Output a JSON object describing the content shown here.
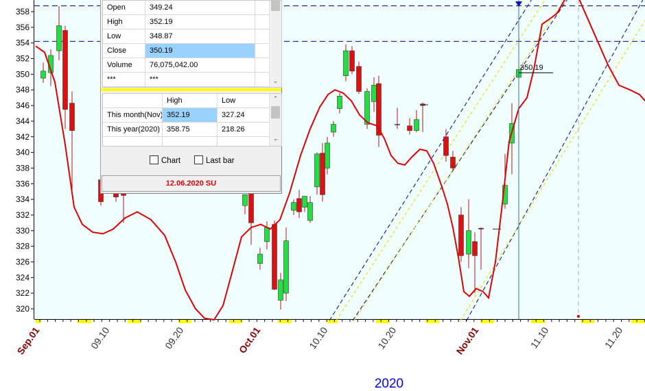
{
  "chart_data": {
    "type": "candlestick",
    "year_label": "2020",
    "y_ticks": [
      320,
      322,
      324,
      326,
      328,
      330,
      332,
      334,
      336,
      338,
      340,
      342,
      344,
      346,
      348,
      350,
      352,
      354,
      356,
      358
    ],
    "ylim": [
      318.5,
      359.8
    ],
    "x_ticks": [
      {
        "label": "Sep.01",
        "bold": true
      },
      {
        "label": "09.10",
        "bold": false
      },
      {
        "label": "09.20",
        "bold": false
      },
      {
        "label": "Oct.01",
        "bold": true
      },
      {
        "label": "10.10",
        "bold": false
      },
      {
        "label": "10.20",
        "bold": false
      },
      {
        "label": "Nov.01",
        "bold": true
      },
      {
        "label": "11.10",
        "bold": false
      },
      {
        "label": "11.20",
        "bold": false
      }
    ],
    "last_price_label": "350.19",
    "horizontal_lines": [
      358.75,
      354.2
    ],
    "candles": [
      {
        "o": 349.5,
        "h": 351.5,
        "l": 348.9,
        "c": 350.4
      },
      {
        "o": 350.2,
        "h": 353.2,
        "l": 348.5,
        "c": 352.4
      },
      {
        "o": 353.0,
        "h": 358.7,
        "l": 351.8,
        "c": 356.2
      },
      {
        "o": 355.6,
        "h": 356.2,
        "l": 343.0,
        "c": 345.5
      },
      {
        "o": 346.3,
        "h": 347.8,
        "l": 335.0,
        "c": 342.8
      },
      {
        "o": 336.5,
        "h": 337.5,
        "l": 333.2,
        "c": 333.7
      },
      {
        "o": 336.0,
        "h": 336.8,
        "l": 333.7,
        "c": 334.3
      },
      {
        "o": 336.4,
        "h": 337.2,
        "l": 331.0,
        "c": 334.5
      },
      {
        "o": 333.2,
        "h": 334.2,
        "l": 332.1,
        "c": 334.6
      },
      {
        "o": 335.0,
        "h": 336.0,
        "l": 328.2,
        "c": 331.0
      },
      {
        "o": 325.8,
        "h": 327.8,
        "l": 325.0,
        "c": 327.0
      },
      {
        "o": 328.6,
        "h": 331.2,
        "l": 327.6,
        "c": 330.4
      },
      {
        "o": 330.8,
        "h": 331.3,
        "l": 322.4,
        "c": 322.5
      },
      {
        "o": 321.1,
        "h": 324.6,
        "l": 319.9,
        "c": 323.7
      },
      {
        "o": 322.0,
        "h": 330.4,
        "l": 321.0,
        "c": 328.7
      },
      {
        "o": 332.6,
        "h": 334.0,
        "l": 332.0,
        "c": 333.6
      },
      {
        "o": 334.1,
        "h": 335.2,
        "l": 331.6,
        "c": 332.4
      },
      {
        "o": 333.0,
        "h": 334.4,
        "l": 332.4,
        "c": 334.4
      },
      {
        "o": 331.3,
        "h": 334.4,
        "l": 331.0,
        "c": 333.6
      },
      {
        "o": 335.6,
        "h": 340.0,
        "l": 334.6,
        "c": 339.8
      },
      {
        "o": 339.9,
        "h": 341.2,
        "l": 333.7,
        "c": 334.6
      },
      {
        "o": 338.0,
        "h": 342.0,
        "l": 337.2,
        "c": 341.2
      },
      {
        "o": 342.6,
        "h": 344.0,
        "l": 342.0,
        "c": 343.6
      },
      {
        "o": 345.6,
        "h": 347.6,
        "l": 345.0,
        "c": 347.2
      },
      {
        "o": 349.8,
        "h": 353.8,
        "l": 349.1,
        "c": 353.0
      },
      {
        "o": 353.0,
        "h": 353.6,
        "l": 350.0,
        "c": 350.4
      },
      {
        "o": 351.0,
        "h": 351.6,
        "l": 347.5,
        "c": 347.8
      },
      {
        "o": 343.6,
        "h": 348.2,
        "l": 343.0,
        "c": 347.8
      },
      {
        "o": 346.5,
        "h": 349.6,
        "l": 345.2,
        "c": 348.6
      },
      {
        "o": 348.8,
        "h": 349.8,
        "l": 340.7,
        "c": 342.2
      },
      {
        "o": 343.6,
        "h": 345.7,
        "l": 343.0,
        "c": 343.6
      },
      {
        "o": 343.4,
        "h": 344.4,
        "l": 342.3,
        "c": 342.8
      },
      {
        "o": 342.8,
        "h": 345.4,
        "l": 342.6,
        "c": 344.2
      },
      {
        "o": 346.2,
        "h": 346.4,
        "l": 342.6,
        "c": 346.0
      },
      {
        "o": 342.0,
        "h": 343.0,
        "l": 338.8,
        "c": 339.6
      },
      {
        "o": 339.4,
        "h": 340.2,
        "l": 337.6,
        "c": 338.0
      },
      {
        "o": 332.0,
        "h": 333.0,
        "l": 326.0,
        "c": 326.8
      },
      {
        "o": 327.0,
        "h": 334.0,
        "l": 325.2,
        "c": 330.0
      },
      {
        "o": 328.6,
        "h": 329.8,
        "l": 322.0,
        "c": 326.8
      },
      {
        "o": 330.3,
        "h": 330.4,
        "l": 325.0,
        "c": 330.2
      },
      {
        "o": 333.4,
        "h": 339.8,
        "l": 332.8,
        "c": 335.8
      },
      {
        "o": 341.2,
        "h": 346.3,
        "l": 337.2,
        "c": 343.7
      },
      {
        "o": 349.6,
        "h": 351.6,
        "l": 349.2,
        "c": 350.6
      }
    ],
    "moving_average_red": [
      [
        52,
        353.6
      ],
      [
        65,
        352.8
      ],
      [
        80,
        349.0
      ],
      [
        95,
        341.0
      ],
      [
        108,
        333.0
      ],
      [
        120,
        330.8
      ],
      [
        135,
        329.8
      ],
      [
        150,
        329.6
      ],
      [
        165,
        330.2
      ],
      [
        182,
        331.6
      ],
      [
        200,
        332.4
      ],
      [
        220,
        331.4
      ],
      [
        240,
        329.4
      ],
      [
        256,
        326.0
      ],
      [
        270,
        322.4
      ],
      [
        285,
        320.0
      ],
      [
        298,
        318.8
      ],
      [
        312,
        318.6
      ],
      [
        325,
        320.4
      ],
      [
        338,
        324.6
      ],
      [
        352,
        329.2
      ],
      [
        366,
        330.4
      ],
      [
        380,
        330.8
      ],
      [
        394,
        330.2
      ],
      [
        408,
        331.4
      ],
      [
        422,
        334.8
      ],
      [
        438,
        339.6
      ],
      [
        452,
        343.0
      ],
      [
        466,
        345.8
      ],
      [
        478,
        347.4
      ],
      [
        488,
        348.0
      ],
      [
        500,
        347.6
      ],
      [
        512,
        346.6
      ],
      [
        524,
        344.8
      ],
      [
        536,
        343.8
      ],
      [
        550,
        343.4
      ],
      [
        560,
        341.8
      ],
      [
        570,
        339.6
      ],
      [
        580,
        338.6
      ],
      [
        590,
        338.4
      ],
      [
        600,
        339.4
      ],
      [
        612,
        340.4
      ],
      [
        622,
        340.2
      ],
      [
        632,
        338.6
      ],
      [
        644,
        335.6
      ],
      [
        652,
        333.4
      ],
      [
        660,
        330.4
      ],
      [
        668,
        326.6
      ],
      [
        676,
        322.2
      ],
      [
        684,
        321.6
      ],
      [
        694,
        322.6
      ],
      [
        704,
        322.2
      ],
      [
        712,
        321.4
      ],
      [
        722,
        326.0
      ],
      [
        732,
        333.4
      ],
      [
        742,
        341.4
      ],
      [
        756,
        345.6
      ],
      [
        768,
        347.0
      ],
      [
        778,
        350.6
      ],
      [
        790,
        356.4
      ],
      [
        800,
        357.0
      ],
      [
        812,
        357.8
      ],
      [
        826,
        360.0
      ],
      [
        842,
        360.0
      ],
      [
        858,
        356.8
      ],
      [
        872,
        354.0
      ],
      [
        886,
        351.2
      ],
      [
        902,
        348.6
      ],
      [
        918,
        348.0
      ],
      [
        932,
        347.4
      ],
      [
        940,
        346.6
      ]
    ],
    "channel_lines_yellow": [
      [
        [
          484,
          318.5
        ],
        [
          792,
          360.0
        ]
      ],
      [
        [
          510,
          318.5
        ],
        [
          820,
          360.0
        ]
      ],
      [
        [
          665,
          318.5
        ],
        [
          935,
          357.0
        ]
      ]
    ],
    "channel_lines_navy": [
      [
        [
          480,
          318.5
        ],
        [
          778,
          360.0
        ]
      ],
      [
        [
          514,
          318.5
        ],
        [
          830,
          360.0
        ]
      ],
      [
        [
          680,
          318.5
        ],
        [
          940,
          360.0
        ]
      ]
    ]
  },
  "info_panel": {
    "ohlc": [
      {
        "label": "Open",
        "value": "349.24"
      },
      {
        "label": "High",
        "value": "352.19"
      },
      {
        "label": "Low",
        "value": "348.87"
      },
      {
        "label": "Close",
        "value": "350.19"
      },
      {
        "label": "Volume",
        "value": "76,075,042.00"
      },
      {
        "label": "***",
        "value": "***"
      }
    ],
    "range_headers": [
      "",
      "High",
      "Low"
    ],
    "ranges": [
      {
        "label": "This month(Nov)",
        "high": "352.19",
        "low": "327.24"
      },
      {
        "label": "This year(2020)",
        "high": "358.75",
        "low": "218.26"
      }
    ],
    "chart_checkbox": "Chart",
    "last_bar_checkbox": "Last bar",
    "date": "12.06.2020 SU"
  },
  "colors": {
    "plot_bg": "#f0feff",
    "up_candle": "#22e040",
    "down_candle": "#e01010",
    "ma_line": "#e00000",
    "grid_line": "#00008b",
    "yellow_marker": "#ffff00",
    "tick_bold": "#8b0000",
    "year_label": "#0000ff"
  }
}
